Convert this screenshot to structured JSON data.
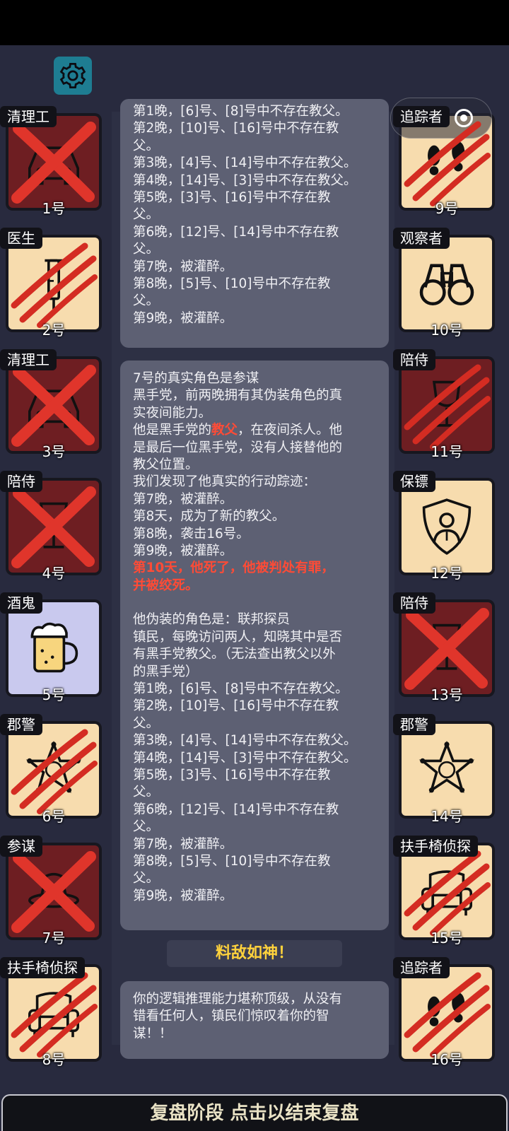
{
  "topbar": {
    "settings_icon": "gear-icon"
  },
  "capsule": {
    "dots": "•••"
  },
  "left_players": [
    {
      "role": "清理工",
      "num": "1号",
      "state": "dead",
      "icon": "car-icon",
      "mark": "x"
    },
    {
      "role": "医生",
      "num": "2号",
      "state": "alive",
      "icon": "syringe-icon",
      "mark": "claw"
    },
    {
      "role": "清理工",
      "num": "3号",
      "state": "dead",
      "icon": "car-icon",
      "mark": "x"
    },
    {
      "role": "陪侍",
      "num": "4号",
      "state": "dead",
      "icon": "wine-glass-icon",
      "mark": "x"
    },
    {
      "role": "酒鬼",
      "num": "5号",
      "state": "drunk",
      "icon": "beer-mug-icon",
      "mark": "none"
    },
    {
      "role": "郡警",
      "num": "6号",
      "state": "alive",
      "icon": "sheriff-badge-icon",
      "mark": "claw"
    },
    {
      "role": "参谋",
      "num": "7号",
      "state": "dead",
      "icon": "hat-icon",
      "mark": "x"
    },
    {
      "role": "扶手椅侦探",
      "num": "8号",
      "state": "alive",
      "icon": "armchair-icon",
      "mark": "claw"
    }
  ],
  "right_players": [
    {
      "role": "追踪者",
      "num": "9号",
      "state": "alive",
      "icon": "footprints-icon",
      "mark": "claw"
    },
    {
      "role": "观察者",
      "num": "10号",
      "state": "alive",
      "icon": "binoculars-icon",
      "mark": "none"
    },
    {
      "role": "陪侍",
      "num": "11号",
      "state": "dead",
      "icon": "wine-glass-icon",
      "mark": "claw"
    },
    {
      "role": "保镖",
      "num": "12号",
      "state": "alive",
      "icon": "shield-person-icon",
      "mark": "none"
    },
    {
      "role": "陪侍",
      "num": "13号",
      "state": "dead",
      "icon": "wine-glass-icon",
      "mark": "x"
    },
    {
      "role": "郡警",
      "num": "14号",
      "state": "alive",
      "icon": "sheriff-badge-icon",
      "mark": "none"
    },
    {
      "role": "扶手椅侦探",
      "num": "15号",
      "state": "alive",
      "icon": "armchair-icon",
      "mark": "claw"
    },
    {
      "role": "追踪者",
      "num": "16号",
      "state": "alive",
      "icon": "footprints-icon",
      "mark": "claw"
    }
  ],
  "log": {
    "top_bubble": [
      "第1晚，[6]号、[8]号中不存在教父。",
      "第2晚，[10]号、[16]号中不存在教",
      "父。",
      "第3晚，[4]号、[14]号中不存在教父。",
      "第4晚，[14]号、[3]号中不存在教父。",
      "第5晚，[3]号、[16]号中不存在教",
      "父。",
      "第6晚，[12]号、[14]号中不存在教",
      "父。",
      "第7晚，被灌醉。",
      "第8晚，[5]号、[10]号中不存在教",
      "父。",
      "第9晚，被灌醉。"
    ],
    "reveal": {
      "line1": "7号的真实角色是参谋",
      "line2": "黑手党，前两晚拥有其伪装角色的真",
      "line3": "实夜间能力。",
      "line4_pre": "他是黑手党的",
      "line4_red": "教父",
      "line4_post": "，在夜间杀人。他",
      "line5": "是最后一位黑手党，没有人接替他的",
      "line6": "教父位置。",
      "line7": "我们发现了他真实的行动踪迹：",
      "line8": "第7晚，被灌醉。",
      "line9": "第8天，成为了新的教父。",
      "line10": "第8晚，袭击16号。",
      "line11": "第9晚，被灌醉。",
      "red1": "第10天，他死了，他被判处有罪，",
      "red2": "并被绞死。",
      "d1": "他伪装的角色是：联邦探员",
      "d2": "镇民，每晚访问两人，知晓其中是否",
      "d3": "有黑手党教父。（无法查出教父以外",
      "d4": "的黑手党）",
      "n1": "第1晚，[6]号、[8]号中不存在教父。",
      "n2": "第2晚，[10]号、[16]号中不存在教",
      "n3": "父。",
      "n4": "第3晚，[4]号、[14]号中不存在教父。",
      "n5": "第4晚，[14]号、[3]号中不存在教父。",
      "n6": "第5晚，[3]号、[16]号中不存在教",
      "n7": "父。",
      "n8": "第6晚，[12]号、[14]号中不存在教",
      "n9": "父。",
      "n10": "第7晚，被灌醉。",
      "n11": "第8晚，[5]号、[10]号中不存在教",
      "n12": "父。",
      "n13": "第9晚，被灌醉。"
    },
    "banner": "料敌如神！",
    "final": {
      "l1": "你的逻辑推理能力堪称顶级，从没有",
      "l2": "错看任何人，镇民们惊叹着你的智",
      "l3": "谋！！"
    }
  },
  "bottom": {
    "label": "复盘阶段 点击以结束复盘"
  },
  "colors": {
    "red_text": "#ff4b36",
    "banner_gold": "#ffd23c",
    "alive_bg": "#f7dcae",
    "dead_bg": "#6e1e22",
    "drunk_bg": "#c9c9ee",
    "gear_bg": "#1e7d92"
  }
}
